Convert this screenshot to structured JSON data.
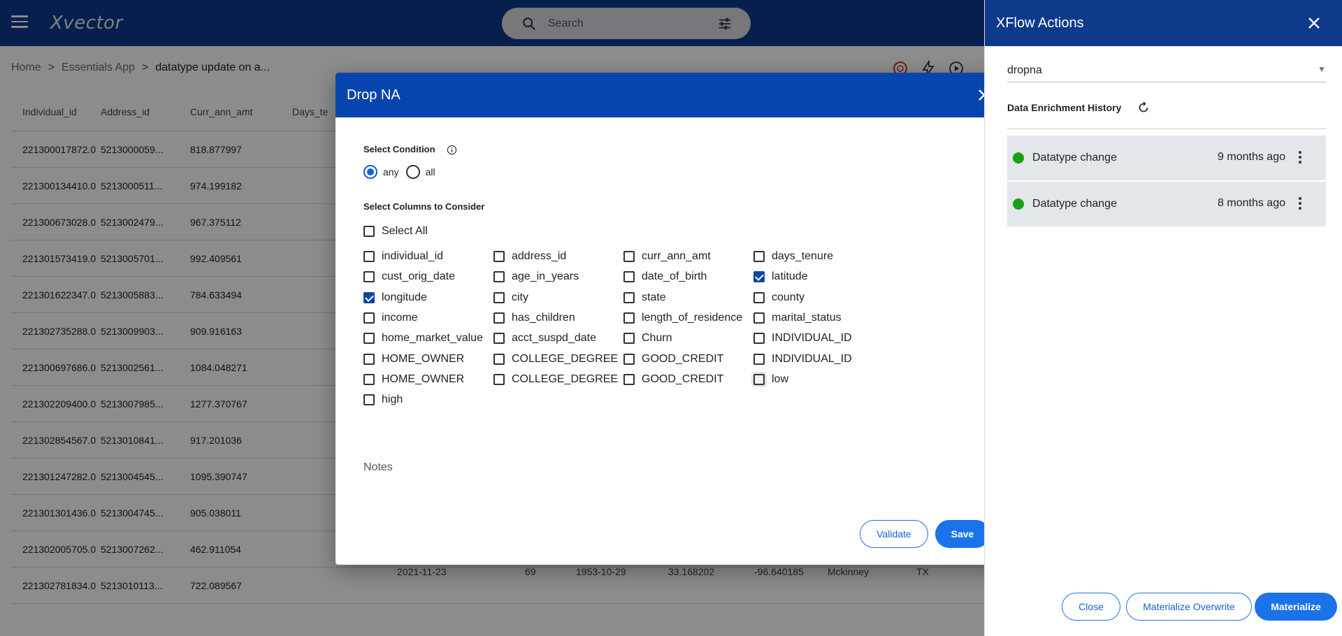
{
  "app": {
    "name": "Xvector"
  },
  "search": {
    "placeholder": "Search"
  },
  "breadcrumb": {
    "items": [
      "Home",
      "Essentials App",
      "datatype update on a..."
    ]
  },
  "table": {
    "columns": [
      "Individual_id",
      "Address_id",
      "Curr_ann_amt",
      "Days_te"
    ],
    "rows": [
      [
        "221300017872.0",
        "5213000059...",
        "818.877997"
      ],
      [
        "221300134410.0",
        "5213000511...",
        "974.199182"
      ],
      [
        "221300673028.0",
        "5213002479...",
        "967.375112"
      ],
      [
        "221301573419.0",
        "5213005701...",
        "992.409561"
      ],
      [
        "221301622347.0",
        "5213005883...",
        "784.633494"
      ],
      [
        "221302735288.0",
        "5213009903...",
        "909.916163"
      ],
      [
        "221300697686.0",
        "5213002561...",
        "1084.048271"
      ],
      [
        "221302209400.0",
        "5213007985...",
        "1277.370767"
      ],
      [
        "221302854567.0",
        "5213010841...",
        "917.201036"
      ],
      [
        "221301247282.0",
        "5213004545...",
        "1095.390747"
      ],
      [
        "221301301436.0",
        "5213004745...",
        "905.038011"
      ],
      [
        "221302005705.0",
        "5213007262...",
        "462.911054"
      ],
      [
        "221302781834.0",
        "5213010113...",
        "722.089567"
      ]
    ],
    "last_row_extra": [
      "2021-11-23",
      "69",
      "1953-10-29",
      "33.168202",
      "-96.640185",
      "Mckinney",
      "TX"
    ]
  },
  "modal": {
    "title": "Drop NA",
    "condition_label": "Select Condition",
    "conditions": [
      {
        "label": "any",
        "selected": true
      },
      {
        "label": "all",
        "selected": false
      }
    ],
    "columns_label": "Select Columns to Consider",
    "select_all_label": "Select All",
    "columns": [
      {
        "label": "individual_id",
        "checked": false
      },
      {
        "label": "address_id",
        "checked": false
      },
      {
        "label": "curr_ann_amt",
        "checked": false
      },
      {
        "label": "days_tenure",
        "checked": false
      },
      {
        "label": "cust_orig_date",
        "checked": false
      },
      {
        "label": "age_in_years",
        "checked": false
      },
      {
        "label": "date_of_birth",
        "checked": false
      },
      {
        "label": "latitude",
        "checked": true
      },
      {
        "label": "longitude",
        "checked": true
      },
      {
        "label": "city",
        "checked": false
      },
      {
        "label": "state",
        "checked": false
      },
      {
        "label": "county",
        "checked": false
      },
      {
        "label": "income",
        "checked": false
      },
      {
        "label": "has_children",
        "checked": false
      },
      {
        "label": "length_of_residence",
        "checked": false
      },
      {
        "label": "marital_status",
        "checked": false
      },
      {
        "label": "home_market_value",
        "checked": false
      },
      {
        "label": "acct_suspd_date",
        "checked": false
      },
      {
        "label": "Churn",
        "checked": false
      },
      {
        "label": "INDIVIDUAL_ID",
        "checked": false
      },
      {
        "label": "HOME_OWNER",
        "checked": false
      },
      {
        "label": "COLLEGE_DEGREE",
        "checked": false
      },
      {
        "label": "GOOD_CREDIT",
        "checked": false
      },
      {
        "label": "INDIVIDUAL_ID",
        "checked": false
      },
      {
        "label": "HOME_OWNER",
        "checked": false
      },
      {
        "label": "COLLEGE_DEGREE",
        "checked": false
      },
      {
        "label": "GOOD_CREDIT",
        "checked": false
      },
      {
        "label": "low",
        "checked": false
      },
      {
        "label": "high",
        "checked": false
      }
    ],
    "notes_placeholder": "Notes",
    "validate_label": "Validate",
    "save_label": "Save"
  },
  "panel": {
    "title": "XFlow Actions",
    "action_value": "dropna",
    "history_label": "Data Enrichment History",
    "history": [
      {
        "label": "Datatype change",
        "time": "9 months ago",
        "status_color": "#18a018"
      },
      {
        "label": "Datatype change",
        "time": "8 months ago",
        "status_color": "#18a018"
      }
    ],
    "close_label": "Close",
    "materialize_overwrite_label": "Materialize Overwrite",
    "materialize_label": "Materialize"
  }
}
